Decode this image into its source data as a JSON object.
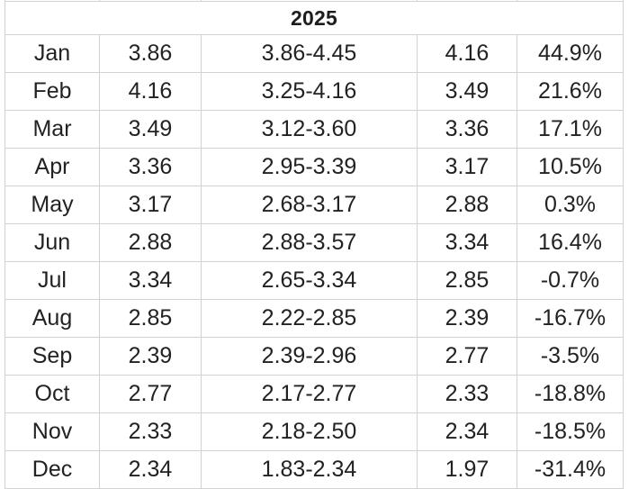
{
  "table": {
    "header": {
      "year_label": "2025",
      "colspan": 5
    },
    "columns": [
      {
        "key": "month",
        "label": ""
      },
      {
        "key": "open",
        "label": ""
      },
      {
        "key": "range",
        "label": ""
      },
      {
        "key": "close",
        "label": ""
      },
      {
        "key": "change",
        "label": ""
      }
    ],
    "rows": [
      {
        "month": "Jan",
        "open": "3.86",
        "range": "3.86-4.45",
        "close": "4.16",
        "change": "44.9%"
      },
      {
        "month": "Feb",
        "open": "4.16",
        "range": "3.25-4.16",
        "close": "3.49",
        "change": "21.6%"
      },
      {
        "month": "Mar",
        "open": "3.49",
        "range": "3.12-3.60",
        "close": "3.36",
        "change": "17.1%"
      },
      {
        "month": "Apr",
        "open": "3.36",
        "range": "2.95-3.39",
        "close": "3.17",
        "change": "10.5%"
      },
      {
        "month": "May",
        "open": "3.17",
        "range": "2.68-3.17",
        "close": "2.88",
        "change": "0.3%"
      },
      {
        "month": "Jun",
        "open": "2.88",
        "range": "2.88-3.57",
        "close": "3.34",
        "change": "16.4%"
      },
      {
        "month": "Jul",
        "open": "3.34",
        "range": "2.65-3.34",
        "close": "2.85",
        "change": "-0.7%"
      },
      {
        "month": "Aug",
        "open": "2.85",
        "range": "2.22-2.85",
        "close": "2.39",
        "change": "-16.7%"
      },
      {
        "month": "Sep",
        "open": "2.39",
        "range": "2.39-2.96",
        "close": "2.77",
        "change": "-3.5%"
      },
      {
        "month": "Oct",
        "open": "2.77",
        "range": "2.17-2.77",
        "close": "2.33",
        "change": "-18.8%"
      },
      {
        "month": "Nov",
        "open": "2.33",
        "range": "2.18-2.50",
        "close": "2.34",
        "change": "-18.5%"
      },
      {
        "month": "Dec",
        "open": "2.34",
        "range": "1.83-2.34",
        "close": "1.97",
        "change": "-31.4%"
      }
    ]
  },
  "colors": {
    "text": "#222222",
    "border": "#d2d2d2",
    "background": "#ffffff"
  }
}
